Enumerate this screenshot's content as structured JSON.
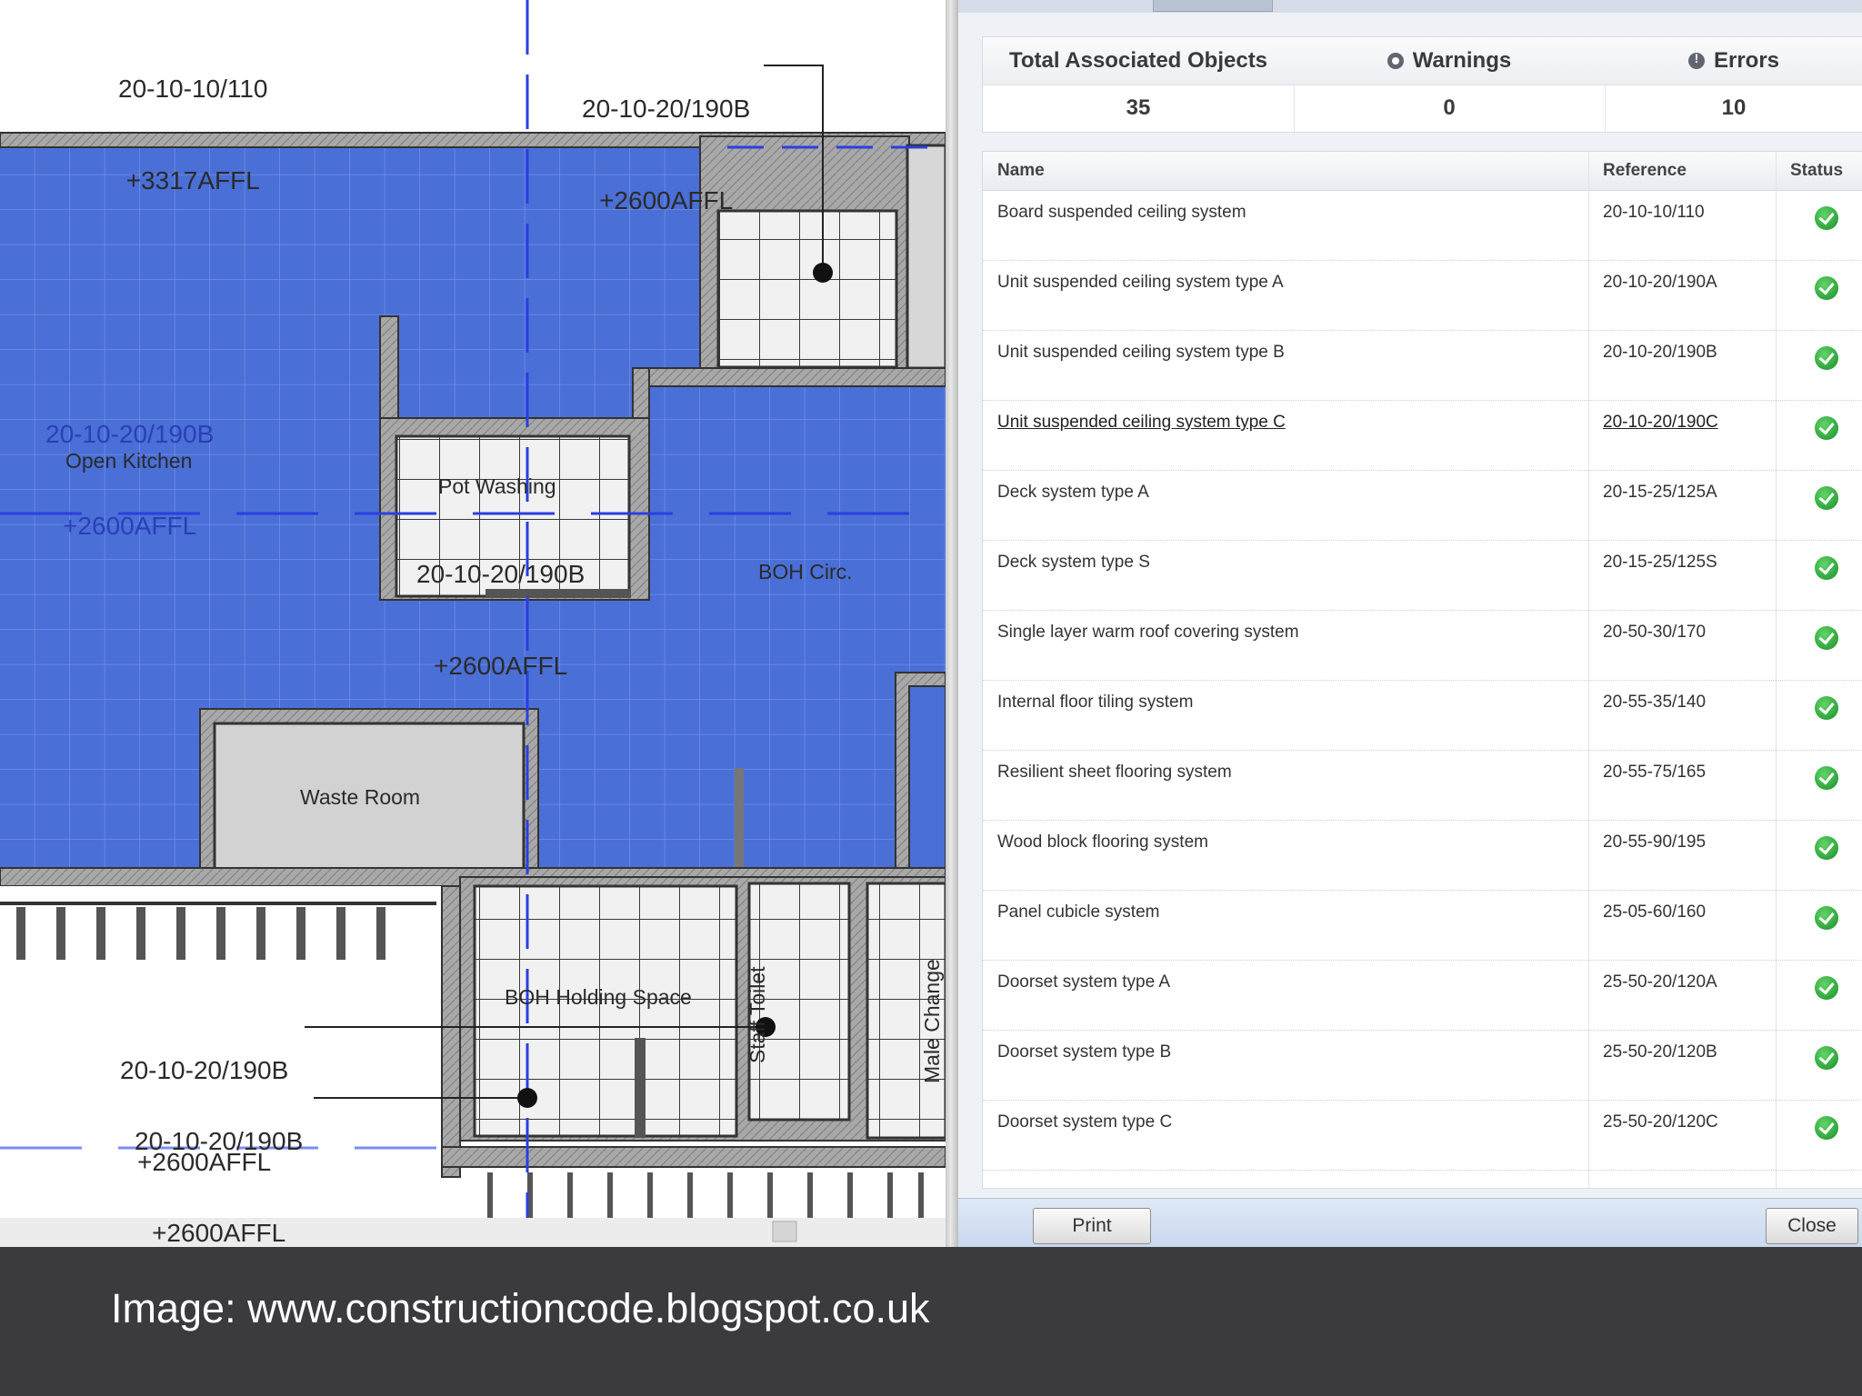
{
  "plan": {
    "tags": [
      {
        "ref": "20-10-10/110",
        "level": "+3317AFFL"
      },
      {
        "ref": "20-10-20/190B",
        "level": "+2600AFFL"
      },
      {
        "ref": "20-10-20/190B",
        "level": "+2600AFFL"
      },
      {
        "ref": "20-10-20/190B",
        "level": "+2600AFFL"
      },
      {
        "ref": "20-10-20/190B",
        "level": "+2600AFFL"
      },
      {
        "ref": "20-10-20/190B",
        "level": "+2600AFFL"
      }
    ],
    "rooms": {
      "open_kitchen": "Open Kitchen",
      "pot_washing": "Pot Washing",
      "boh_circ": "BOH Circ.",
      "waste_room": "Waste Room",
      "boh_holding": "BOH Holding Space",
      "staff_toilet": "Staff Toilet",
      "male_change": "Male Change"
    }
  },
  "summary": {
    "total_label": "Total Associated Objects",
    "total_value": "35",
    "warnings_label": "Warnings",
    "warnings_value": "0",
    "errors_label": "Errors",
    "errors_value": "10"
  },
  "grid": {
    "columns": {
      "name": "Name",
      "reference": "Reference",
      "status": "Status"
    },
    "rows": [
      {
        "name": "Board suspended ceiling system",
        "reference": "20-10-10/110",
        "status": "ok"
      },
      {
        "name": "Unit suspended ceiling system type A",
        "reference": "20-10-20/190A",
        "status": "ok"
      },
      {
        "name": "Unit suspended ceiling system type B",
        "reference": "20-10-20/190B",
        "status": "ok"
      },
      {
        "name": "Unit suspended ceiling system type C",
        "reference": "20-10-20/190C",
        "status": "ok"
      },
      {
        "name": "Deck system type A",
        "reference": "20-15-25/125A",
        "status": "ok"
      },
      {
        "name": "Deck system type S",
        "reference": "20-15-25/125S",
        "status": "ok"
      },
      {
        "name": "Single layer warm roof covering system",
        "reference": "20-50-30/170",
        "status": "ok"
      },
      {
        "name": "Internal floor tiling system",
        "reference": "20-55-35/140",
        "status": "ok"
      },
      {
        "name": "Resilient sheet flooring system",
        "reference": "20-55-75/165",
        "status": "ok"
      },
      {
        "name": "Wood block flooring system",
        "reference": "20-55-90/195",
        "status": "ok"
      },
      {
        "name": "Panel cubicle system",
        "reference": "25-05-60/160",
        "status": "ok"
      },
      {
        "name": "Doorset system type A",
        "reference": "25-50-20/120A",
        "status": "ok"
      },
      {
        "name": "Doorset system type B",
        "reference": "25-50-20/120B",
        "status": "ok"
      },
      {
        "name": "Doorset system type C",
        "reference": "25-50-20/120C",
        "status": "ok"
      }
    ]
  },
  "buttons": {
    "print": "Print",
    "close": "Close"
  },
  "caption": "Image: www.constructioncode.blogspot.co.uk",
  "colors": {
    "plan_fill": "#4a6fd6",
    "status_ok": "#2ea43a",
    "caption_bg": "#3b3b3d"
  }
}
